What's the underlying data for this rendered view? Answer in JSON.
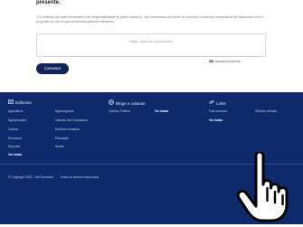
{
  "page_title_fragment": "presente.",
  "comment_form": {
    "notice": "* O conteúdo de cada comentário é de responsabilidade de quem realizá-lo. Nos reservamos ao direito de reprovar ou eliminar comentários em desacordo com o propósito do site ou que contenham palavras ofensivas.",
    "placeholder": "Digite aqui seu comentário",
    "char_count": "500",
    "char_count_label": "caracteres restantes",
    "submit_label": "Comentar"
  },
  "footer": {
    "editorias": {
      "title": "Editorias",
      "icon": "news-icon",
      "links": [
        "Agricultura",
        "Agropecuária",
        "Cultura",
        "Economia",
        "Esportes",
        "Ver todas",
        "Agronegócios",
        "Câmara dos Deputados",
        "Direitos Humanos",
        "Educação",
        "Saúde"
      ]
    },
    "blogs": {
      "title": "Blogs e colunas",
      "icon": "globe-icon",
      "links": [
        "Opinião Pública",
        "Ver todas"
      ]
    },
    "links": {
      "title": "Links",
      "icon": "link-icon",
      "links": [
        "Fale conosco",
        "Ver todas",
        "Últimas notícias"
      ]
    },
    "copyright": "© Copyright 2020 - DM Sudoeste",
    "rights": "Todos os direitos reservados",
    "separator": "-"
  },
  "colors": {
    "footer_bg": "#0d2b6b",
    "button_bg": "#12255a"
  },
  "cursor_icon": "hand-pointer-icon"
}
